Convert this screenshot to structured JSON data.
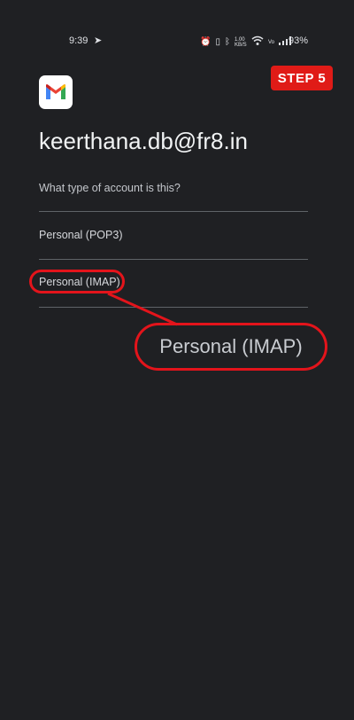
{
  "status_bar": {
    "time": "9:39",
    "battery": "93%",
    "net_speed": "1.00 KB/S"
  },
  "step_badge": "STEP 5",
  "account": {
    "email": "keerthana.db@fr8.in",
    "question": "What type of account is this?"
  },
  "options": [
    {
      "label": "Personal (POP3)"
    },
    {
      "label": "Personal (IMAP)"
    }
  ],
  "zoom_callout": {
    "label": "Personal (IMAP)"
  },
  "colors": {
    "background": "#1f2023",
    "highlight": "#e3141b",
    "badge": "#e01b17"
  }
}
